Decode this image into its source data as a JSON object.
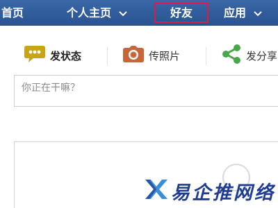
{
  "nav": {
    "home": "首页",
    "profile": "个人主页",
    "friends": "好友",
    "apps": "应用"
  },
  "publisher": {
    "tabs": [
      {
        "label": "发状态",
        "icon": "speech-bubble-icon"
      },
      {
        "label": "传照片",
        "icon": "camera-icon"
      },
      {
        "label": "发分享",
        "icon": "share-icon"
      }
    ],
    "status_placeholder": "你正在干嘛？"
  },
  "watermark": {
    "text": "易企推网络"
  },
  "colors": {
    "nav_bg": "#2f5a9a",
    "highlight_border": "#d61d4c",
    "status_icon": "#c9a414",
    "photo_icon": "#c8663a",
    "share_icon": "#4aa64a",
    "watermark": "#1f3c95"
  }
}
